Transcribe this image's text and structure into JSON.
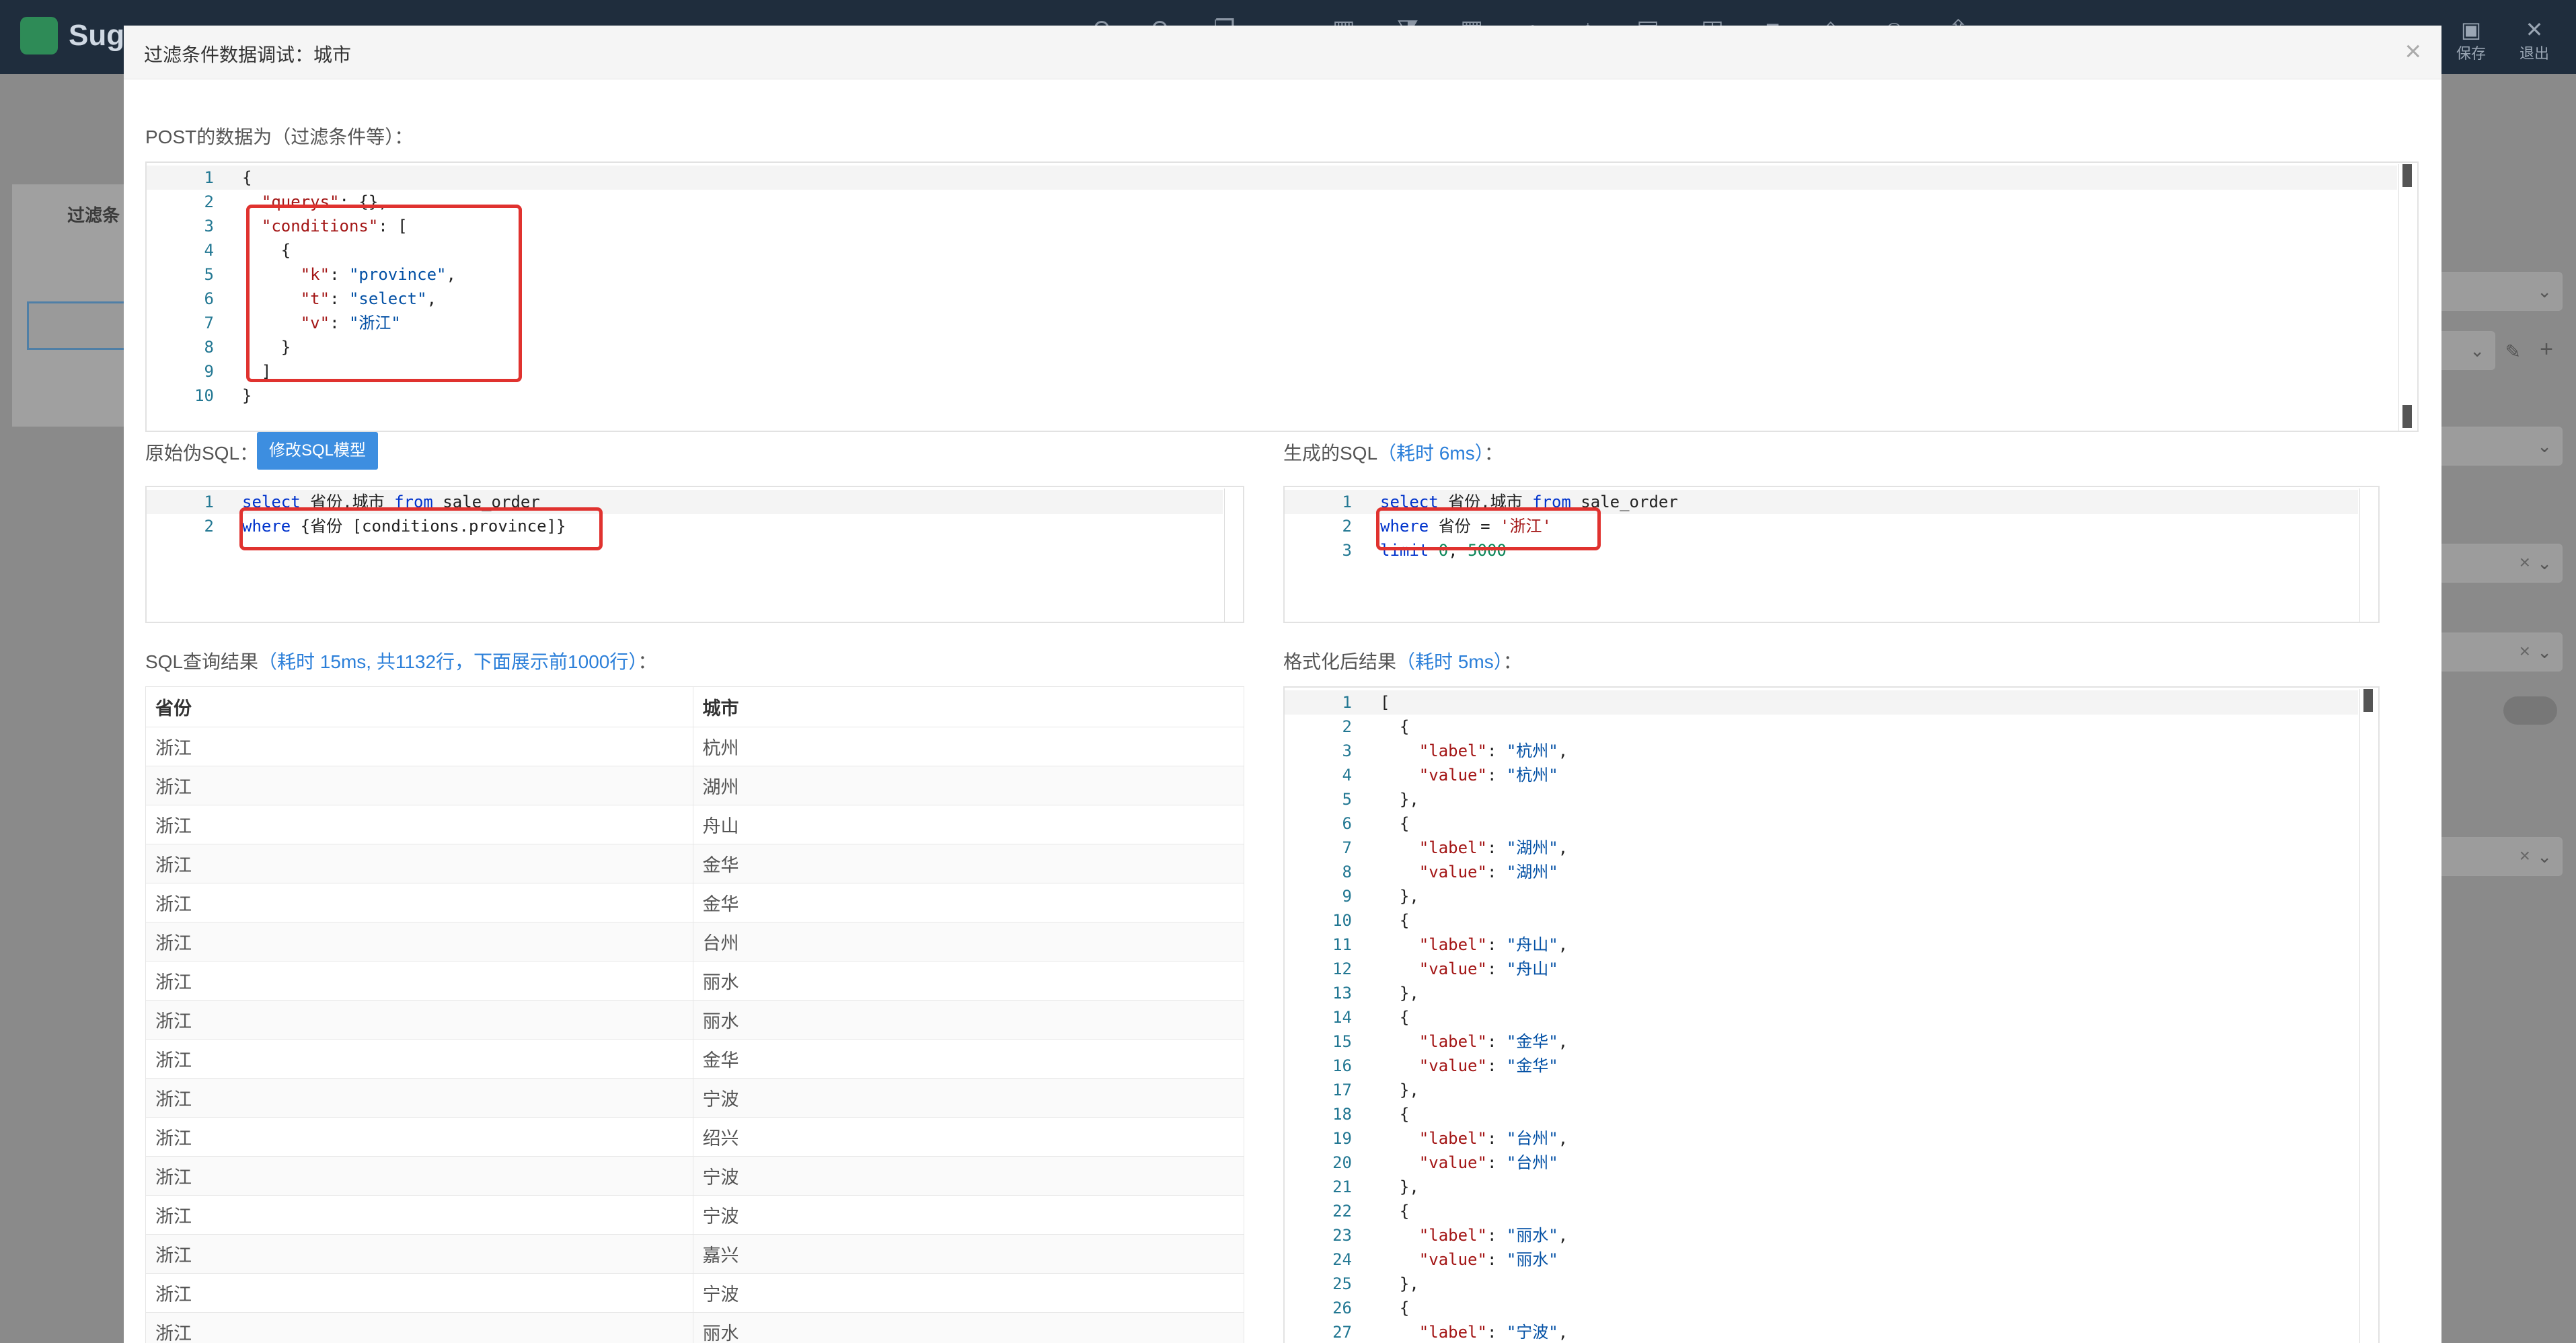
{
  "app": {
    "brand": "Sug",
    "toolbar_icons": [
      "undo-icon",
      "redo-icon",
      "copy-icon",
      "search-icon",
      "chart-icon",
      "filter-icon",
      "table-icon",
      "pie-icon",
      "map-icon",
      "grid-icon",
      "layout-icon",
      "menu-icon",
      "layers-icon",
      "user-icon",
      "upload-icon"
    ],
    "save_label": "保存",
    "exit_label": "退出",
    "bg_label": "过滤条"
  },
  "modal": {
    "title": "过滤条件数据调试：城市",
    "close_glyph": "×"
  },
  "post": {
    "label": "POST的数据为（过滤条件等）：",
    "lines": [
      "{",
      "  \"querys\": {},",
      "  \"conditions\": [",
      "    {",
      "      \"k\": \"province\",",
      "      \"t\": \"select\",",
      "      \"v\": \"浙江\"",
      "    }",
      "  ]",
      "}"
    ]
  },
  "raw_sql": {
    "label": "原始伪SQL：",
    "edit_button": "修改SQL模型",
    "lines": [
      "select 省份,城市 from sale_order",
      "where {省份 [conditions.province]}"
    ]
  },
  "gen_sql": {
    "label": "生成的SQL",
    "timing": "（耗时 6ms）",
    "suffix": "：",
    "lines": [
      "select 省份,城市 from sale_order",
      "where 省份 = '浙江'",
      "limit 0, 5000"
    ]
  },
  "sql_result": {
    "label": "SQL查询结果",
    "timing": "（耗时 15ms, 共1132行，下面展示前1000行）",
    "suffix": "：",
    "columns": [
      "省份",
      "城市"
    ],
    "rows": [
      [
        "浙江",
        "杭州"
      ],
      [
        "浙江",
        "湖州"
      ],
      [
        "浙江",
        "舟山"
      ],
      [
        "浙江",
        "金华"
      ],
      [
        "浙江",
        "金华"
      ],
      [
        "浙江",
        "台州"
      ],
      [
        "浙江",
        "丽水"
      ],
      [
        "浙江",
        "丽水"
      ],
      [
        "浙江",
        "金华"
      ],
      [
        "浙江",
        "宁波"
      ],
      [
        "浙江",
        "绍兴"
      ],
      [
        "浙江",
        "宁波"
      ],
      [
        "浙江",
        "宁波"
      ],
      [
        "浙江",
        "嘉兴"
      ],
      [
        "浙江",
        "宁波"
      ],
      [
        "浙江",
        "丽水"
      ]
    ]
  },
  "formatted": {
    "label": "格式化后结果",
    "timing": "（耗时 5ms）",
    "suffix": "：",
    "lines": [
      "[",
      "  {",
      "    \"label\": \"杭州\",",
      "    \"value\": \"杭州\"",
      "  },",
      "  {",
      "    \"label\": \"湖州\",",
      "    \"value\": \"湖州\"",
      "  },",
      "  {",
      "    \"label\": \"舟山\",",
      "    \"value\": \"舟山\"",
      "  },",
      "  {",
      "    \"label\": \"金华\",",
      "    \"value\": \"金华\"",
      "  },",
      "  {",
      "    \"label\": \"台州\",",
      "    \"value\": \"台州\"",
      "  },",
      "  {",
      "    \"label\": \"丽水\",",
      "    \"value\": \"丽水\"",
      "  },",
      "  {",
      "    \"label\": \"宁波\","
    ]
  }
}
